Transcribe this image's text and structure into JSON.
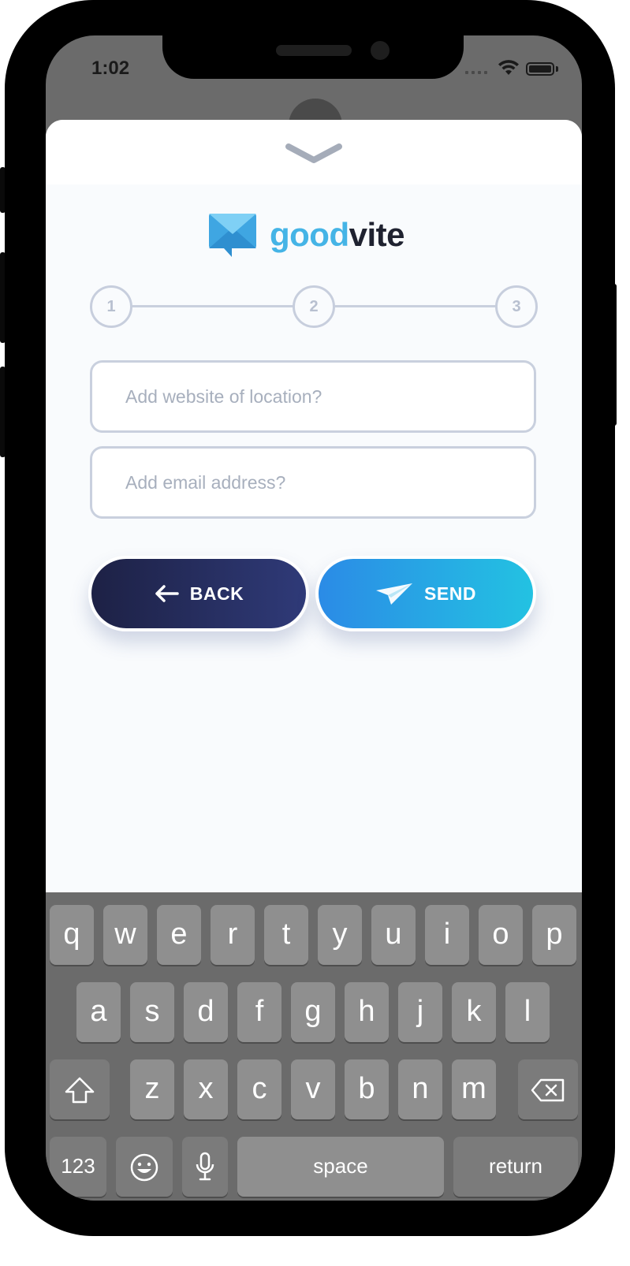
{
  "status_bar": {
    "time": "1:02"
  },
  "brand": {
    "part1": "good",
    "part2": "vite"
  },
  "stepper": {
    "steps": [
      "1",
      "2",
      "3"
    ]
  },
  "form": {
    "website_placeholder": "Add website of location?",
    "email_placeholder": "Add email address?"
  },
  "buttons": {
    "back_label": "BACK",
    "send_label": "SEND"
  },
  "keyboard": {
    "row1": [
      "q",
      "w",
      "e",
      "r",
      "t",
      "y",
      "u",
      "i",
      "o",
      "p"
    ],
    "row2": [
      "a",
      "s",
      "d",
      "f",
      "g",
      "h",
      "j",
      "k",
      "l"
    ],
    "row3": [
      "z",
      "x",
      "c",
      "v",
      "b",
      "n",
      "m"
    ],
    "numbers_label": "123",
    "space_label": "space",
    "return_label": "return"
  },
  "colors": {
    "brand_blue": "#45b4e6",
    "brand_dark": "#1f2230",
    "back_gradient_start": "#1d2145",
    "send_gradient_start": "#2b8be6",
    "send_gradient_end": "#23c2e2"
  }
}
